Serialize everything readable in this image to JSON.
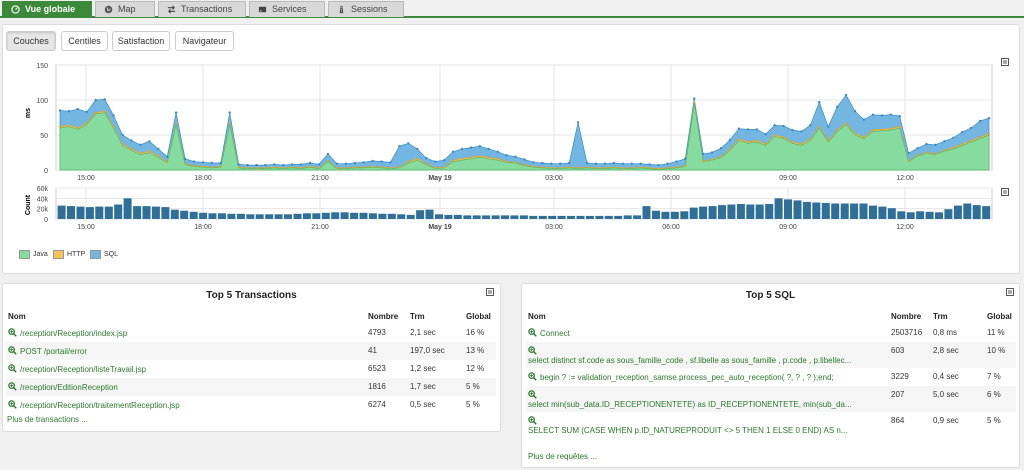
{
  "tabs": [
    {
      "label": "Vue globale",
      "icon": "dashboard-icon",
      "active": true
    },
    {
      "label": "Map",
      "icon": "globe-icon",
      "active": false
    },
    {
      "label": "Transactions",
      "icon": "transfer-arrows-icon",
      "active": false
    },
    {
      "label": "Services",
      "icon": "server-icon",
      "active": false
    },
    {
      "label": "Sessions",
      "icon": "road-icon",
      "active": false
    }
  ],
  "view_buttons": [
    "Couches",
    "Centiles",
    "Satisfaction",
    "Navigateur"
  ],
  "colors": {
    "java": "#86dc9e",
    "http": "#f7c257",
    "sql": "#74b6e2",
    "count": "#2f6f98",
    "accent": "#3a8a3a",
    "link": "#2a7a2a"
  },
  "chart_data": [
    {
      "type": "area",
      "stacked": true,
      "ylabel": "ms",
      "ylim": [
        0,
        150
      ],
      "yticks": [
        "0",
        "50",
        "100",
        "150"
      ],
      "x_tick_labels": [
        "15:00",
        "18:00",
        "21:00",
        "May 19",
        "03:00",
        "06:00",
        "09:00",
        "12:00"
      ],
      "series": [
        {
          "name": "Java",
          "values": [
            60,
            62,
            58,
            65,
            80,
            82,
            60,
            35,
            28,
            22,
            25,
            18,
            10,
            65,
            8,
            5,
            4,
            3,
            4,
            65,
            3,
            2,
            2,
            2,
            3,
            2,
            3,
            2,
            4,
            2,
            12,
            2,
            2,
            3,
            3,
            4,
            3,
            2,
            3,
            10,
            14,
            8,
            2,
            3,
            12,
            14,
            16,
            18,
            16,
            14,
            11,
            10,
            6,
            4,
            3,
            2,
            2,
            3,
            2,
            3,
            2,
            2,
            3,
            2,
            2,
            3,
            2,
            1,
            2,
            3,
            5,
            95,
            12,
            14,
            18,
            28,
            42,
            38,
            40,
            35,
            48,
            45,
            38,
            35,
            42,
            60,
            40,
            55,
            65,
            50,
            45,
            55,
            56,
            57,
            60,
            12,
            20,
            24,
            22,
            27,
            30,
            35,
            40,
            45,
            50
          ]
        },
        {
          "name": "HTTP",
          "values": [
            2,
            2,
            2,
            2,
            2,
            2,
            2,
            2,
            2,
            2,
            2,
            2,
            1,
            2,
            1,
            1,
            1,
            1,
            1,
            2,
            1,
            1,
            1,
            1,
            1,
            1,
            1,
            1,
            1,
            1,
            1,
            1,
            1,
            1,
            1,
            1,
            1,
            1,
            1,
            2,
            2,
            1,
            1,
            1,
            2,
            2,
            2,
            2,
            2,
            2,
            1,
            1,
            1,
            1,
            1,
            1,
            1,
            1,
            1,
            1,
            1,
            1,
            1,
            1,
            1,
            1,
            1,
            1,
            1,
            1,
            1,
            2,
            1,
            1,
            1,
            2,
            2,
            2,
            2,
            2,
            2,
            2,
            2,
            2,
            2,
            2,
            2,
            2,
            2,
            2,
            2,
            2,
            2,
            2,
            2,
            1,
            1,
            1,
            1,
            1,
            2,
            2,
            2,
            2,
            2
          ]
        },
        {
          "name": "SQL",
          "values": [
            23,
            20,
            27,
            16,
            18,
            17,
            16,
            13,
            12,
            12,
            14,
            10,
            8,
            15,
            7,
            6,
            6,
            6,
            5,
            15,
            4,
            4,
            4,
            4,
            4,
            4,
            4,
            5,
            5,
            5,
            10,
            6,
            6,
            6,
            7,
            8,
            8,
            8,
            30,
            26,
            14,
            8,
            9,
            10,
            12,
            14,
            14,
            14,
            12,
            10,
            9,
            8,
            8,
            6,
            6,
            6,
            6,
            6,
            65,
            6,
            6,
            6,
            6,
            6,
            6,
            5,
            5,
            5,
            6,
            8,
            10,
            5,
            10,
            10,
            12,
            13,
            15,
            18,
            16,
            14,
            14,
            16,
            17,
            18,
            20,
            35,
            20,
            33,
            40,
            32,
            25,
            22,
            20,
            20,
            15,
            11,
            10,
            12,
            13,
            13,
            14,
            17,
            18,
            23,
            22
          ]
        }
      ]
    },
    {
      "type": "bar",
      "ylabel": "Count",
      "ylim": [
        0,
        60000
      ],
      "yticks": [
        "0",
        "20k",
        "40k",
        "60k"
      ],
      "x_tick_labels": [
        "15:00",
        "18:00",
        "21:00",
        "May 19",
        "03:00",
        "06:00",
        "09:00",
        "12:00"
      ],
      "series": [
        {
          "name": "Count",
          "values": [
            26000,
            25000,
            24000,
            23000,
            24000,
            24000,
            28000,
            40000,
            25000,
            25000,
            24000,
            23000,
            18000,
            16000,
            14000,
            12000,
            11000,
            11000,
            10000,
            10000,
            9000,
            9000,
            9000,
            9000,
            9000,
            10000,
            11000,
            11000,
            12000,
            13000,
            13000,
            12000,
            12000,
            11000,
            10000,
            10000,
            9000,
            8000,
            17000,
            18000,
            9000,
            8000,
            8000,
            7000,
            7000,
            7000,
            7000,
            7000,
            7000,
            7000,
            6000,
            6000,
            6000,
            6000,
            6000,
            6000,
            6000,
            6000,
            6000,
            6000,
            7000,
            7000,
            25000,
            16000,
            14000,
            14000,
            15000,
            22000,
            24000,
            25000,
            27000,
            28000,
            29000,
            28000,
            28000,
            29000,
            40000,
            38000,
            36000,
            33000,
            32000,
            31000,
            30000,
            30000,
            30000,
            30000,
            26000,
            24000,
            21000,
            15000,
            13000,
            15000,
            14000,
            13000,
            19000,
            26000,
            30000,
            27000,
            25000
          ]
        }
      ]
    }
  ],
  "transactions": {
    "title": "Top 5 Transactions",
    "headers": [
      "Nom",
      "Nombre",
      "Trm",
      "Global"
    ],
    "rows": [
      {
        "name": "/reception/Reception/index.jsp",
        "count": "4793",
        "trm": "2,1 sec",
        "global": "16 %"
      },
      {
        "name": "POST /portail/error",
        "count": "41",
        "trm": "197,0 sec",
        "global": "13 %"
      },
      {
        "name": "/reception/Reception/listeTravail.jsp",
        "count": "6523",
        "trm": "1,2 sec",
        "global": "12 %"
      },
      {
        "name": "/reception/EditionReception",
        "count": "1816",
        "trm": "1,7 sec",
        "global": "5 %"
      },
      {
        "name": "/reception/Reception/traitementReception.jsp",
        "count": "6274",
        "trm": "0,5 sec",
        "global": "5 %"
      }
    ],
    "more": "Plus de transactions ..."
  },
  "sql": {
    "title": "Top 5 SQL",
    "headers": [
      "Nom",
      "Nombre",
      "Trm",
      "Global"
    ],
    "rows": [
      {
        "name": "Connect",
        "count": "2503716",
        "trm": "0,8 ms",
        "global": "11 %"
      },
      {
        "name": "select distinct sf.code as sous_famille_code , sf.libelle as sous_famille , p.code , p.libellec...",
        "count": "603",
        "trm": "2,8 sec",
        "global": "10 %"
      },
      {
        "name": "begin ? := validation_reception_samse.process_pec_auto_reception( ?, ? , ? );end;",
        "count": "3229",
        "trm": "0,4 sec",
        "global": "7 %"
      },
      {
        "name": "select min(sub_data.ID_RECEPTIONENTETE) as ID_RECEPTIONENTETE, min(sub_da...",
        "count": "207",
        "trm": "5,0 sec",
        "global": "6 %"
      },
      {
        "name": "SELECT SUM (CASE WHEN p.ID_NATUREPRODUIT <> 5 THEN 1 ELSE 0 END) AS n...",
        "count": "864",
        "trm": "0,9 sec",
        "global": "5 %"
      }
    ],
    "more": "Plus de requêtes ..."
  }
}
